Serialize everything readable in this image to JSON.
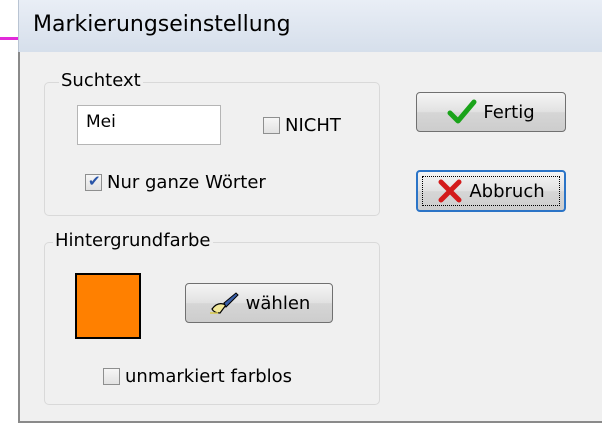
{
  "window": {
    "title": "Markierungseinstellung"
  },
  "search_group": {
    "title": "Suchtext",
    "input_value": "Mei",
    "not_checkbox": {
      "label": "NICHT",
      "checked": false
    },
    "whole_words_checkbox": {
      "label": "Nur ganze Wörter",
      "checked": true
    }
  },
  "background_group": {
    "title": "Hintergrundfarbe",
    "color": "#ff8000",
    "choose_button_label": "wählen",
    "unmarked_checkbox": {
      "label": "unmarkiert farblos",
      "checked": false
    }
  },
  "buttons": {
    "ok_label": "Fertig",
    "cancel_label": "Abbruch"
  },
  "colors": {
    "accent_line": "#e12ad9",
    "check_green": "#1aa31a",
    "cancel_red": "#d31a1a"
  }
}
